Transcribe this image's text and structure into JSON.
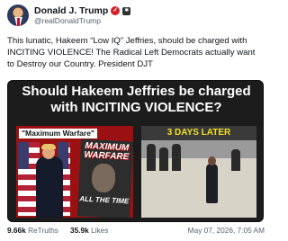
{
  "post": {
    "display_name": "Donald J. Trump",
    "handle": "@realDonaldTrump",
    "text": "This lunatic, Hakeem “Low IQ” Jeffries, should be charged with INCITING VIOLENCE! The Radical Left Democrats actually want to Destroy our Country. President DJT"
  },
  "media": {
    "headline": "Should Hakeem Jeffries be charged with INCITING VIOLENCE?",
    "left_panel": {
      "label": "\"Maximum Warfare\"",
      "poster_title": "MAXIMUM WARFARE",
      "poster_tag": "ALL THE TIME"
    },
    "right_panel": {
      "label": "3 DAYS LATER"
    }
  },
  "stats": {
    "retruths_count": "9.66k",
    "retruths_label": "ReTruths",
    "likes_count": "35.9k",
    "likes_label": "Likes",
    "timestamp": "May 07, 2026, 7:05 AM"
  },
  "icons": {
    "verified_badge": "check-badge-icon",
    "extra_badge": "platform-icon"
  },
  "colors": {
    "headline_text": "#ffffff",
    "highlight_label": "#f3df26",
    "verified_badge": "#d2232a",
    "muted_text": "#536471"
  }
}
